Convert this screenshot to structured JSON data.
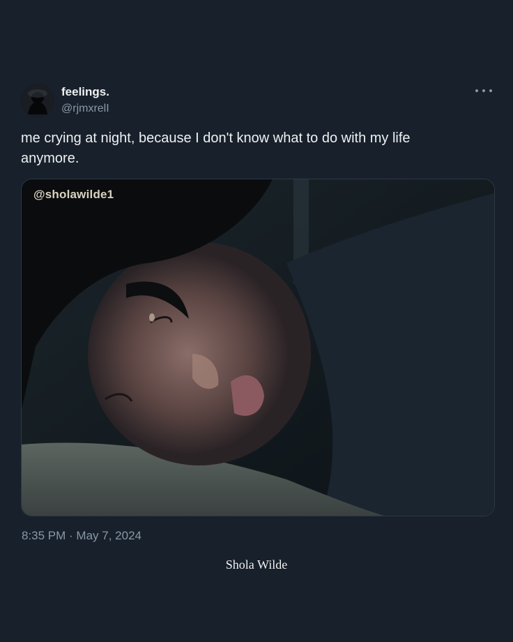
{
  "tweet": {
    "display_name": "feelings.",
    "handle": "@rjmxrelI",
    "text": "me crying at night, because I don't know what to do with my life anymore.",
    "timestamp": "8:35 PM · May 7, 2024",
    "media": {
      "watermark": "@sholawilde1",
      "description_icon": "photo"
    },
    "more_icon": "ellipsis-icon"
  },
  "footer": {
    "credit": "Shola Wilde"
  },
  "colors": {
    "background": "#17202b",
    "text_primary": "#eff1f2",
    "text_secondary": "#8b98a5"
  }
}
